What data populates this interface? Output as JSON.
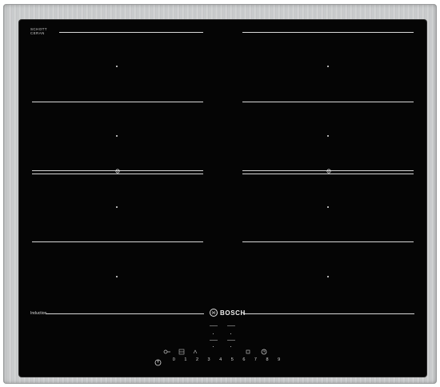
{
  "cooktop": {
    "glass_label_line1": "SCHOTT",
    "glass_label_line2": "CERAN",
    "glass_label_line3": "",
    "type_label": "Induction",
    "brand_name": "BOSCH",
    "colors": {
      "glass": "#050505",
      "frame": "#c6c8c9",
      "lines": "#d8d8d8"
    },
    "control_panel": {
      "power_levels": [
        "0",
        "1",
        "2",
        "3",
        "4",
        "5",
        "6",
        "7",
        "8",
        "9"
      ],
      "icons": [
        "power-icon",
        "child-lock-icon",
        "flex-zone-icon",
        "boost-icon",
        "keep-warm-icon",
        "timer-icon"
      ]
    }
  }
}
